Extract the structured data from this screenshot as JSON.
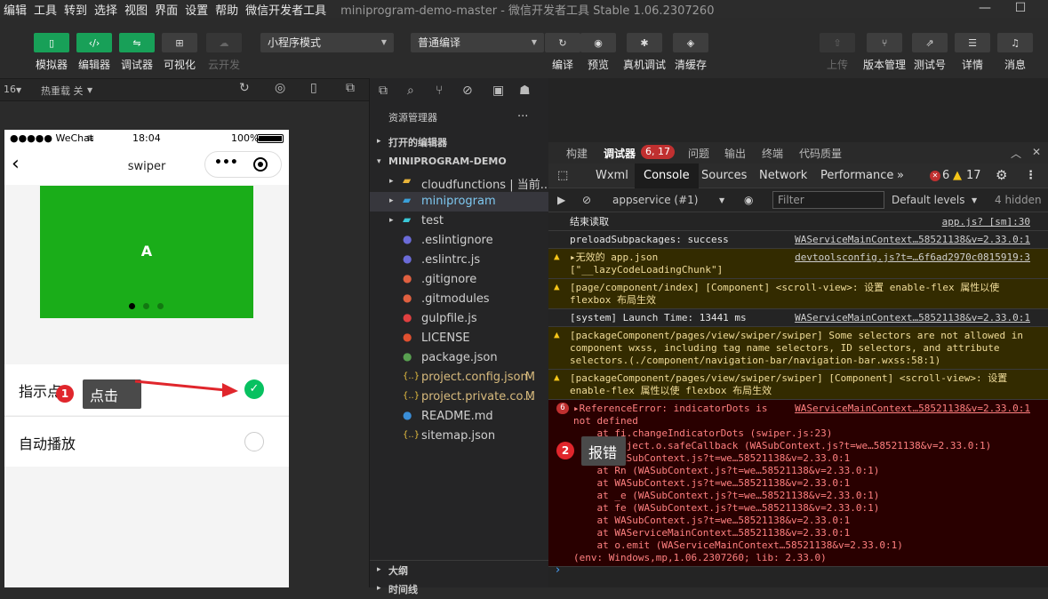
{
  "menubar": {
    "items": [
      "编辑",
      "工具",
      "转到",
      "选择",
      "视图",
      "界面",
      "设置",
      "帮助",
      "微信开发者工具"
    ],
    "title": "miniprogram-demo-master - 微信开发者工具 Stable 1.06.2307260"
  },
  "toolbar": {
    "left": [
      {
        "label": "模拟器",
        "icon": "phone-icon",
        "active": true
      },
      {
        "label": "编辑器",
        "icon": "code-icon",
        "active": true
      },
      {
        "label": "调试器",
        "icon": "debugger-icon",
        "active": true
      },
      {
        "label": "可视化",
        "icon": "visual-icon",
        "active": false
      },
      {
        "label": "云开发",
        "icon": "cloud-icon",
        "active": false
      }
    ],
    "mode_select": "小程序模式",
    "compile_select": "普通编译",
    "middle": [
      {
        "label": "编译",
        "icon": "refresh-icon"
      },
      {
        "label": "预览",
        "icon": "eye-icon"
      },
      {
        "label": "真机调试",
        "icon": "bug-icon"
      },
      {
        "label": "清缓存",
        "icon": "layers-icon"
      }
    ],
    "right": [
      {
        "label": "上传",
        "icon": "upload-icon",
        "disabled": true
      },
      {
        "label": "版本管理",
        "icon": "branch-icon"
      },
      {
        "label": "测试号",
        "icon": "test-icon"
      },
      {
        "label": "详情",
        "icon": "menu-icon"
      },
      {
        "label": "消息",
        "icon": "bell-icon"
      }
    ]
  },
  "subbar": {
    "zoom": "16",
    "hotreload": "热重载 关"
  },
  "phone": {
    "signal": "●●●●● WeChat",
    "time": "18:04",
    "battery": "100%",
    "nav_title": "swiper",
    "capsule_menu": "•••",
    "slide_label": "A",
    "rows": [
      {
        "label": "指示点",
        "checked": true
      },
      {
        "label": "自动播放",
        "checked": false
      }
    ]
  },
  "explorer": {
    "title": "资源管理器",
    "more": "···",
    "open_editors": "打开的编辑器",
    "project": "MINIPROGRAM-DEMO",
    "items": [
      {
        "name": "cloudfunctions | 当前...",
        "type": "folder",
        "color": "#e8b43a",
        "mark": ""
      },
      {
        "name": "miniprogram",
        "type": "folder",
        "color": "#3aa0d8",
        "mark": "",
        "highlight": true
      },
      {
        "name": "test",
        "type": "folder",
        "color": "#3ac8d8",
        "mark": ""
      },
      {
        "name": ".eslintignore",
        "type": "file",
        "color": "#6b6bd8",
        "mark": ""
      },
      {
        "name": ".eslintrc.js",
        "type": "file",
        "color": "#6b6bd8",
        "mark": ""
      },
      {
        "name": ".gitignore",
        "type": "file",
        "color": "#e06040",
        "mark": ""
      },
      {
        "name": ".gitmodules",
        "type": "file",
        "color": "#e06040",
        "mark": ""
      },
      {
        "name": "gulpfile.js",
        "type": "file",
        "color": "#e04040",
        "mark": ""
      },
      {
        "name": "LICENSE",
        "type": "file",
        "color": "#e05030",
        "mark": ""
      },
      {
        "name": "package.json",
        "type": "file",
        "color": "#58a050",
        "mark": ""
      },
      {
        "name": "project.config.json",
        "type": "json",
        "color": "#e8c040",
        "mark": "M"
      },
      {
        "name": "project.private.co...",
        "type": "json",
        "color": "#e8c040",
        "mark": "M"
      },
      {
        "name": "README.md",
        "type": "file",
        "color": "#3a8ed8",
        "mark": ""
      },
      {
        "name": "sitemap.json",
        "type": "json",
        "color": "#e8c040",
        "mark": ""
      }
    ],
    "outline": "大纲",
    "timeline": "时间线"
  },
  "devtools": {
    "top_tabs": [
      "构建",
      "调试器",
      "问题",
      "输出",
      "终端",
      "代码质量"
    ],
    "debugger_badge": "6, 17",
    "console_tabs": [
      "Wxml",
      "Console",
      "Sources",
      "Network",
      "Performance"
    ],
    "more_tabs": "»",
    "error_count": "6",
    "warn_count": "17",
    "context": "appservice (#1)",
    "filter_placeholder": "Filter",
    "levels": "Default levels",
    "hidden": "4 hidden"
  },
  "console_logs": [
    {
      "level": "info",
      "msg": "结束读取",
      "src": "app.js? [sm]:30"
    },
    {
      "level": "info",
      "msg": "preloadSubpackages: success",
      "src": "WAServiceMainContext…58521138&v=2.33.0:1"
    },
    {
      "level": "warn",
      "msg": "▸无效的 app.json\n[\"__lazyCodeLoadingChunk\"]",
      "src": "devtoolsconfig.js?t=…6f6ad2970c0815919:3"
    },
    {
      "level": "warn",
      "msg": "[page/component/index] [Component] <scroll-view>: 设置 enable-flex 属性以使\nflexbox 布局生效",
      "src": ""
    },
    {
      "level": "info",
      "msg": "[system] Launch Time: 13441 ms",
      "src": "WAServiceMainContext…58521138&v=2.33.0:1"
    },
    {
      "level": "warn",
      "msg": "[packageComponent/pages/view/swiper/swiper] Some selectors are not allowed in\ncomponent wxss, including tag name selectors, ID selectors, and attribute\nselectors.(./component/navigation-bar/navigation-bar.wxss:58:1)",
      "src": ""
    },
    {
      "level": "warn",
      "msg": "[packageComponent/pages/view/swiper/swiper] [Component] <scroll-view>: 设置\nenable-flex 属性以使 flexbox 布局生效",
      "src": ""
    },
    {
      "level": "error",
      "badge": "6",
      "msg": "▸ReferenceError: indicatorDots is\nnot defined\n    at fi.changeIndicatorDots (swiper.js:23)\n    at Object.o.safeCallback (WASubContext.js?t=we…58521138&v=2.33.0:1)\n    at WASubContext.js?t=we…58521138&v=2.33.0:1\n    at Rn (WASubContext.js?t=we…58521138&v=2.33.0:1)\n    at WASubContext.js?t=we…58521138&v=2.33.0:1\n    at _e (WASubContext.js?t=we…58521138&v=2.33.0:1)\n    at fe (WASubContext.js?t=we…58521138&v=2.33.0:1)\n    at WASubContext.js?t=we…58521138&v=2.33.0:1\n    at WAServiceMainContext…58521138&v=2.33.0:1\n    at o.emit (WAServiceMainContext…58521138&v=2.33.0:1)\n(env: Windows,mp,1.06.2307260; lib: 2.33.0)",
      "src": "WAServiceMainContext…58521138&v=2.33.0:1"
    }
  ],
  "prompt": "›",
  "annotations": [
    {
      "num": "1",
      "label": "点击"
    },
    {
      "num": "2",
      "label": "报错"
    }
  ],
  "colors": {
    "accent": "#18a058",
    "swiper": "#1aad19",
    "error_badge": "#c03030",
    "annotation": "#e0262c"
  }
}
